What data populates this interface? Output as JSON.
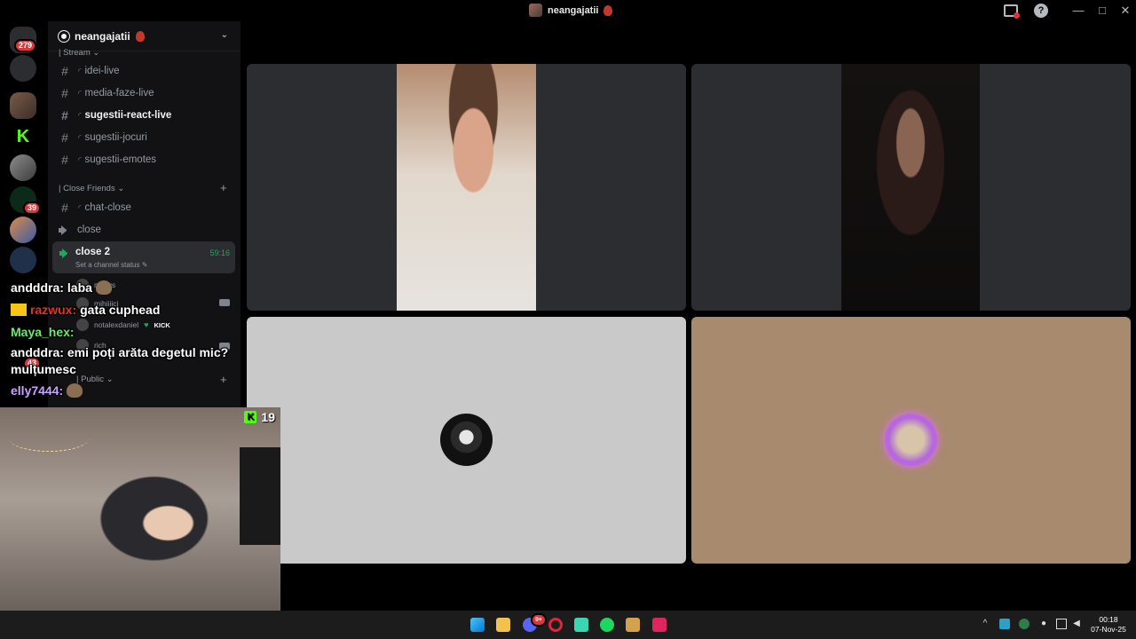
{
  "window": {
    "title": "neangajatii",
    "help_label": "?",
    "minimize": "—",
    "maximize": "□",
    "close": "✕"
  },
  "rail": {
    "badges": [
      "279",
      "39",
      "43"
    ]
  },
  "server": {
    "name": "neangajatii",
    "chevron": "⌄"
  },
  "channels": {
    "category_stream": "| Stream ⌄",
    "items": [
      {
        "name": "idei-live"
      },
      {
        "name": "media-faze-live"
      },
      {
        "name": "sugestii-react-live"
      },
      {
        "name": "sugestii-jocuri"
      },
      {
        "name": "sugestii-emotes"
      }
    ],
    "category_close": "| Close Friends ⌄",
    "plus": "+",
    "chat_close": "chat-close",
    "voice_close": "close",
    "voice_close2": {
      "name": "close 2",
      "status": "Set a channel status ✎",
      "time": "59:16"
    },
    "members": [
      "mailys",
      "mihiiiicj",
      "notalexdaniel",
      "rich"
    ],
    "kick_label": "KICK",
    "category_public": "| Public ⌄"
  },
  "chat": [
    {
      "user": "andddra:",
      "message": "laba",
      "user_color": "#ffffff"
    },
    {
      "user": "razwux:",
      "message": "gata cuphead",
      "user_color": "#e0342a"
    },
    {
      "user": "Maya_hex:",
      "message": "",
      "user_color": "#6ee86e"
    },
    {
      "user": "andddra:",
      "message": "emi poți arăta degetul mic?",
      "user_color": "#ffffff"
    },
    {
      "user": "",
      "message": "mulțumesc",
      "user_color": "#ffffff"
    },
    {
      "user": "elly7444:",
      "message": "",
      "user_color": "#c6a4ff"
    }
  ],
  "webcam": {
    "viewer_count": "19",
    "platform_icon": "kick-icon"
  },
  "taskbar": {
    "time": "00:18",
    "date": "07-Nov-25",
    "discord_badge": "9+"
  },
  "colors": {
    "accent_green": "#23a55a",
    "kick_green": "#53fc18",
    "badge_red": "#da373c"
  }
}
